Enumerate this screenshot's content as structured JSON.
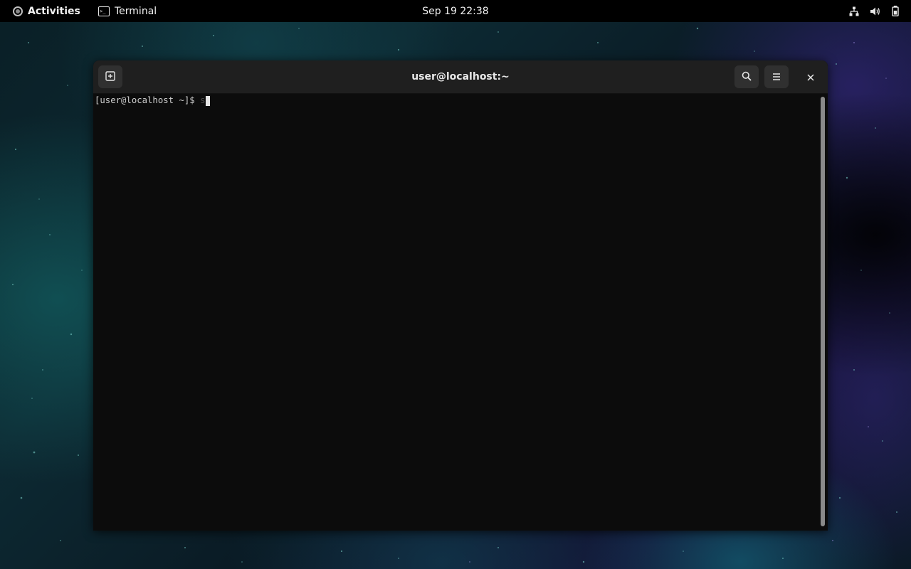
{
  "topbar": {
    "activities_label": "Activities",
    "app_name": "Terminal",
    "clock": "Sep 19  22:38",
    "tray_icons": [
      "network-icon",
      "volume-icon",
      "battery-icon"
    ]
  },
  "window": {
    "title": "user@localhost:~",
    "header_buttons": [
      "new-tab-icon",
      "search-icon",
      "hamburger-menu-icon",
      "close-icon"
    ]
  },
  "terminal": {
    "prompt": "[user@localhost ~]$ ",
    "typed_text": "",
    "ghost_text": "s"
  },
  "colors": {
    "topbar_bg": "#000000",
    "headerbar_bg": "#1f1f1f",
    "terminal_bg": "#0c0c0c",
    "terminal_fg": "#cfcfcf",
    "button_bg": "#303030"
  }
}
